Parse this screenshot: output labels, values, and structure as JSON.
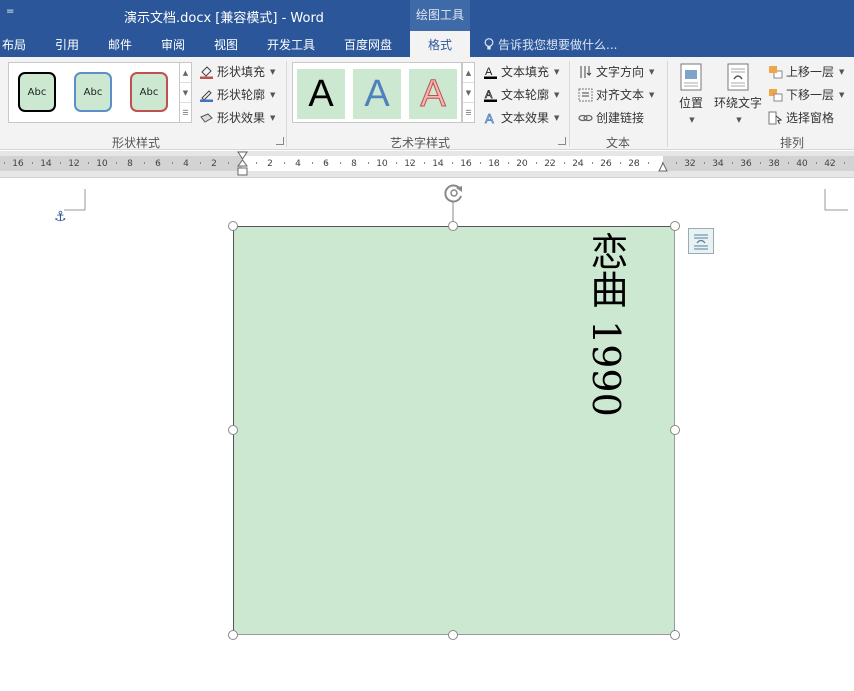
{
  "titlebar": {
    "qat_symbol": "=",
    "title": "演示文档.docx [兼容模式] - Word",
    "context_tab": "绘图工具"
  },
  "tabs": [
    {
      "label": "布局"
    },
    {
      "label": "引用"
    },
    {
      "label": "邮件"
    },
    {
      "label": "审阅"
    },
    {
      "label": "视图"
    },
    {
      "label": "开发工具"
    },
    {
      "label": "百度网盘"
    },
    {
      "label": "格式",
      "active": true
    }
  ],
  "tell_me": "告诉我您想要做什么...",
  "ribbon": {
    "shape_styles": {
      "label": "形状样式",
      "samples": [
        {
          "text": "Abc",
          "border": "#000000"
        },
        {
          "text": "Abc",
          "border": "#5b8fc9"
        },
        {
          "text": "Abc",
          "border": "#c0504d"
        }
      ],
      "fill": "形状填充",
      "outline": "形状轮廓",
      "effects": "形状效果"
    },
    "wordart_styles": {
      "label": "艺术字样式",
      "samples": [
        {
          "text": "A",
          "color": "#000000"
        },
        {
          "text": "A",
          "color": "#4f81bd"
        },
        {
          "text": "A",
          "color": "#f4a7a7"
        }
      ],
      "text_fill": "文本填充",
      "text_outline": "文本轮廓",
      "text_effects": "文本效果"
    },
    "text": {
      "label": "文本",
      "direction": "文字方向",
      "align": "对齐文本",
      "link": "创建链接"
    },
    "arrange": {
      "label": "排列",
      "position": "位置",
      "wrap": "环绕文字",
      "bring_forward": "上移一层",
      "send_backward": "下移一层",
      "selection_pane": "选择窗格"
    }
  },
  "ruler": {
    "left_ticks": [
      "16",
      "14",
      "12",
      "10",
      "8",
      "6",
      "4",
      "2"
    ],
    "right_ticks": [
      "2",
      "4",
      "6",
      "8",
      "10",
      "12",
      "14",
      "16",
      "18",
      "20",
      "22",
      "24",
      "26",
      "28"
    ],
    "outer_ticks": [
      "32",
      "34",
      "36",
      "38",
      "40",
      "42"
    ]
  },
  "document": {
    "textbox_text": "恋曲 1990",
    "textbox_fill": "#cde8d1"
  }
}
